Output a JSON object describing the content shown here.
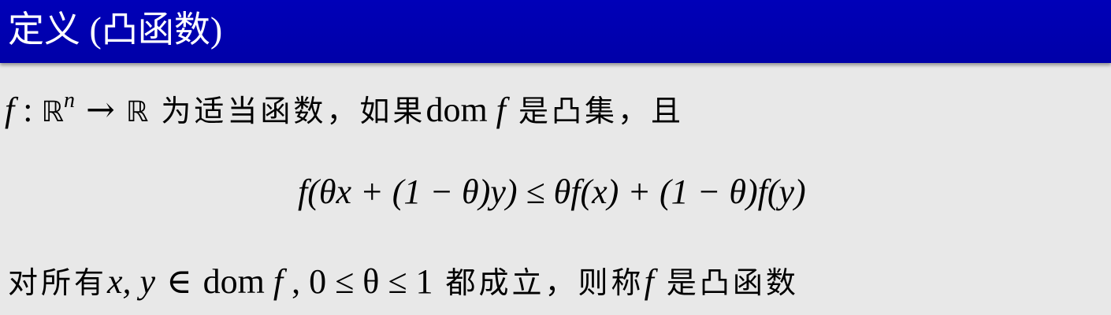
{
  "header": {
    "title": "定义 (凸函数)"
  },
  "definition": {
    "line1": {
      "f": "f",
      "colon": " : ",
      "domain_set": "ℝ",
      "exponent": "n",
      "arrow": " → ",
      "codomain_set": "ℝ",
      "text_a": " 为适当函数，如果",
      "dom": "dom",
      "f2": " f",
      "text_b": " 是凸集，且"
    },
    "formula": "f(θx + (1 − θ)y) ≤ θf(x) + (1 − θ)f(y)",
    "line3": {
      "text_a": "对所有",
      "vars": "x, y",
      "in": " ∈ ",
      "dom": "dom",
      "f": " f",
      "cond": " , 0 ≤ θ ≤ 1",
      "text_b": " 都成立，则称",
      "f2": "f",
      "text_c": " 是凸函数"
    }
  }
}
